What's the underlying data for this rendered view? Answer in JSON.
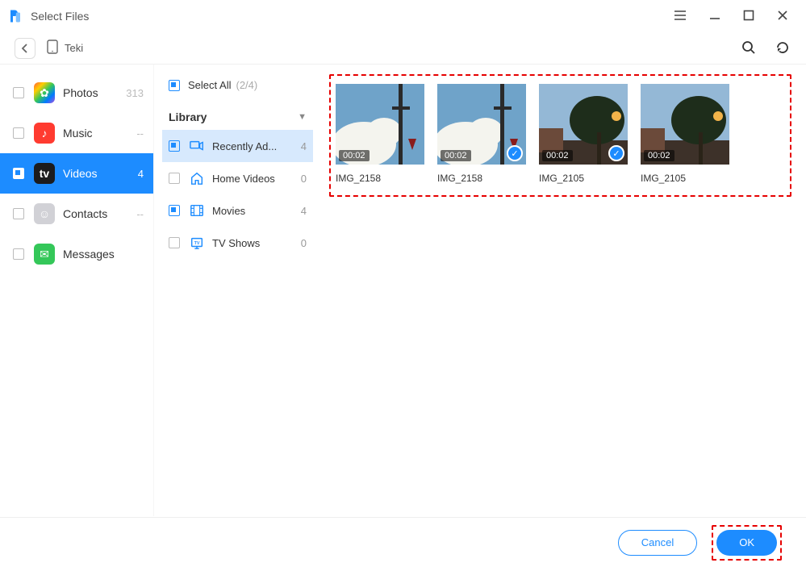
{
  "titlebar": {
    "title": "Select Files"
  },
  "toolbar": {
    "device_name": "Teki"
  },
  "sidebar": {
    "items": [
      {
        "label": "Photos",
        "count": "313"
      },
      {
        "label": "Music",
        "count": "--"
      },
      {
        "label": "Videos",
        "count": "4"
      },
      {
        "label": "Contacts",
        "count": "--"
      },
      {
        "label": "Messages",
        "count": ""
      }
    ]
  },
  "middle": {
    "select_all_label": "Select All",
    "select_all_count": "(2/4)",
    "library_label": "Library",
    "items": [
      {
        "label": "Recently Ad...",
        "count": "4",
        "checked": "mixed",
        "active": true
      },
      {
        "label": "Home Videos",
        "count": "0",
        "checked": "false"
      },
      {
        "label": "Movies",
        "count": "4",
        "checked": "mixed"
      },
      {
        "label": "TV Shows",
        "count": "0",
        "checked": "false"
      }
    ]
  },
  "videos": [
    {
      "name": "IMG_2158",
      "duration": "00:02",
      "selected": false,
      "kind": "cloud"
    },
    {
      "name": "IMG_2158",
      "duration": "00:02",
      "selected": true,
      "kind": "cloud"
    },
    {
      "name": "IMG_2105",
      "duration": "00:02",
      "selected": true,
      "kind": "tree"
    },
    {
      "name": "IMG_2105",
      "duration": "00:02",
      "selected": false,
      "kind": "tree"
    }
  ],
  "footer": {
    "cancel": "Cancel",
    "ok": "OK"
  }
}
